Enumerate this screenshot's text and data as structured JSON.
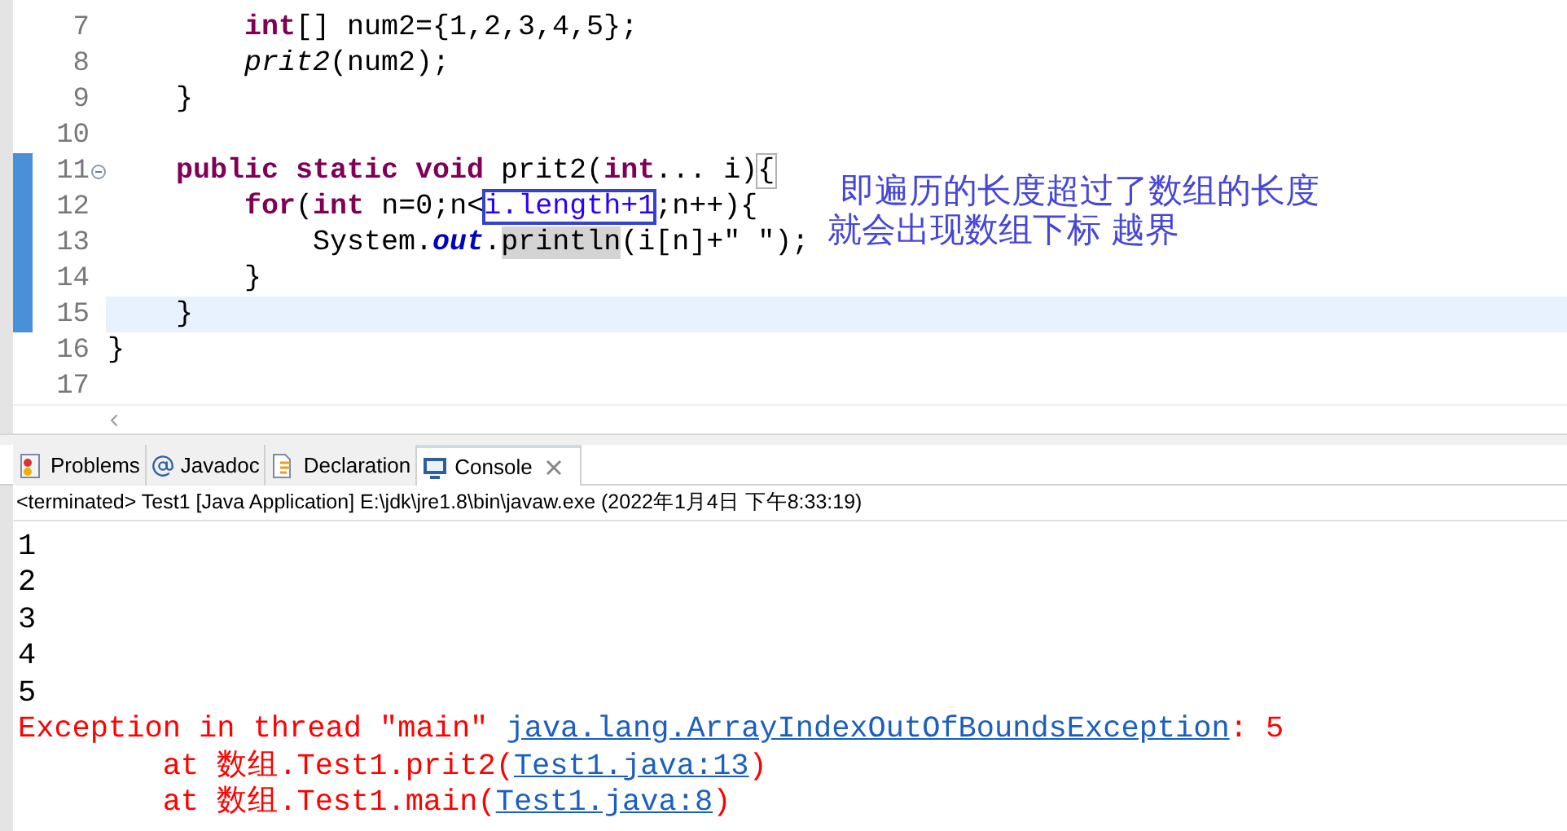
{
  "editor": {
    "lines": [
      {
        "number": "7",
        "current": false,
        "changed": false,
        "fold_marker": false,
        "segments": [
          {
            "text": "        int",
            "kind": "keyword"
          },
          {
            "text": "[] num2={1,2,3,4,5};",
            "kind": "plain"
          }
        ]
      },
      {
        "number": "8",
        "current": false,
        "changed": false,
        "fold_marker": false,
        "segments": [
          {
            "text": "        prit2",
            "kind": "italic"
          },
          {
            "text": "(num2);",
            "kind": "plain"
          }
        ]
      },
      {
        "number": "9",
        "current": false,
        "changed": false,
        "fold_marker": false,
        "segments": [
          {
            "text": "    }",
            "kind": "plain"
          }
        ]
      },
      {
        "number": "10",
        "current": false,
        "changed": false,
        "fold_marker": false
      },
      {
        "number": "11",
        "current": false,
        "changed": true,
        "fold_marker": true,
        "segments": [
          {
            "text": "    public static void",
            "kind": "keyword"
          },
          {
            "text": " prit2(",
            "kind": "plain"
          },
          {
            "text": "int",
            "kind": "keyword"
          },
          {
            "text": "... i)",
            "kind": "plain"
          },
          {
            "text": "{",
            "kind": "bracket"
          }
        ]
      },
      {
        "number": "12",
        "current": false,
        "changed": true,
        "fold_marker": false,
        "segments": [
          {
            "text": "        for",
            "kind": "keyword"
          },
          {
            "text": "(",
            "kind": "plain"
          },
          {
            "text": "int",
            "kind": "keyword"
          },
          {
            "text": " n=0;n<",
            "kind": "plain"
          },
          {
            "text": "i.length+1",
            "kind": "boxed"
          },
          {
            "text": ";n++){",
            "kind": "plain"
          }
        ]
      },
      {
        "number": "13",
        "current": false,
        "changed": true,
        "fold_marker": false,
        "segments": [
          {
            "text": "            System.",
            "kind": "plain"
          },
          {
            "text": "out",
            "kind": "field"
          },
          {
            "text": ".",
            "kind": "plain"
          },
          {
            "text": "println",
            "kind": "occurrence"
          },
          {
            "text": "(i[n]+\" \");",
            "kind": "plain"
          }
        ]
      },
      {
        "number": "14",
        "current": false,
        "changed": true,
        "fold_marker": false,
        "segments": [
          {
            "text": "        }",
            "kind": "plain"
          }
        ]
      },
      {
        "number": "15",
        "current": true,
        "changed": true,
        "fold_marker": false,
        "segments": [
          {
            "text": "    }",
            "kind": "plain"
          }
        ]
      },
      {
        "number": "16",
        "current": false,
        "changed": false,
        "fold_marker": false,
        "segments": [
          {
            "text": "}",
            "kind": "plain"
          }
        ]
      },
      {
        "number": "17",
        "current": false,
        "changed": false,
        "fold_marker": false
      }
    ],
    "annotation": [
      "即遍历的长度超过了数组的长度",
      "就会出现数组下标 越界"
    ]
  },
  "tabs": [
    {
      "label": "Problems",
      "selected": false
    },
    {
      "label": "Javadoc",
      "selected": false
    },
    {
      "label": "Declaration",
      "selected": false
    },
    {
      "label": "Console",
      "selected": true
    }
  ],
  "console": {
    "header": "<terminated> Test1 [Java Application] E:\\jdk\\jre1.8\\bin\\javaw.exe (2022年1月4日 下午8:33:19)",
    "lines": [
      {
        "kind": "output",
        "segments": [
          {
            "text": "1",
            "link": false
          }
        ]
      },
      {
        "kind": "output",
        "segments": [
          {
            "text": "2",
            "link": false
          }
        ]
      },
      {
        "kind": "output",
        "segments": [
          {
            "text": "3",
            "link": false
          }
        ]
      },
      {
        "kind": "output",
        "segments": [
          {
            "text": "4",
            "link": false
          }
        ]
      },
      {
        "kind": "output",
        "segments": [
          {
            "text": "5",
            "link": false
          }
        ]
      },
      {
        "kind": "error",
        "segments": [
          {
            "text": "Exception in thread \"main\" ",
            "link": false
          },
          {
            "text": "java.lang.ArrayIndexOutOfBoundsException",
            "link": true
          },
          {
            "text": ": 5",
            "link": false
          }
        ]
      },
      {
        "kind": "error",
        "segments": [
          {
            "text": "        at 数组.Test1.prit2(",
            "link": false
          },
          {
            "text": "Test1.java:13",
            "link": true
          },
          {
            "text": ")",
            "link": false
          }
        ]
      },
      {
        "kind": "error",
        "segments": [
          {
            "text": "        at 数组.Test1.main(",
            "link": false
          },
          {
            "text": "Test1.java:8",
            "link": true
          },
          {
            "text": ")",
            "link": false
          }
        ]
      }
    ]
  }
}
